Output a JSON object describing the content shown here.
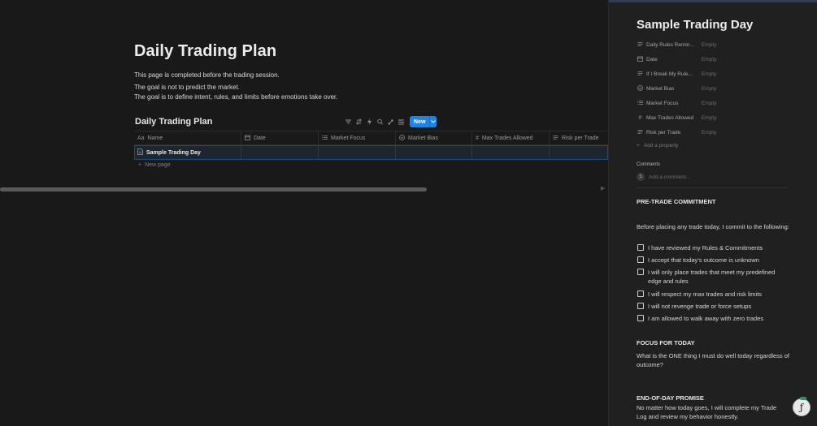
{
  "page": {
    "title": "Daily Trading Plan",
    "lines": [
      "This page is completed before the trading session.",
      "The goal is not to predict the market.",
      "The goal is to define intent, rules, and limits before emotions take over."
    ]
  },
  "database": {
    "title": "Daily Trading Plan",
    "new_label": "New",
    "toolbar_icons": [
      "filter-icon",
      "sort-icon",
      "automation-icon",
      "search-icon",
      "expand-icon",
      "settings-icon"
    ],
    "columns": [
      {
        "label": "Name",
        "icon": "Aa"
      },
      {
        "label": "Date",
        "icon": "calendar-icon"
      },
      {
        "label": "Market Focus",
        "icon": "list-icon"
      },
      {
        "label": "Market Bias",
        "icon": "select-icon"
      },
      {
        "label": "Max Trades Allowed",
        "icon": "#"
      },
      {
        "label": "Risk per Trade",
        "icon": "text-icon"
      }
    ],
    "rows": [
      {
        "name": "Sample Trading Day"
      }
    ],
    "new_page_label": "New page"
  },
  "panel": {
    "title": "Sample Trading Day",
    "properties": [
      {
        "name": "Daily Rules Remin...",
        "value": "Empty",
        "icon": "text-icon"
      },
      {
        "name": "Date",
        "value": "Empty",
        "icon": "calendar-icon"
      },
      {
        "name": "If I Break My Rule...",
        "value": "Empty",
        "icon": "text-icon"
      },
      {
        "name": "Market Bias",
        "value": "Empty",
        "icon": "select-icon"
      },
      {
        "name": "Market Focus",
        "value": "Empty",
        "icon": "list-icon"
      },
      {
        "name": "Max Trades Allowed",
        "value": "Empty",
        "icon": "number-icon"
      },
      {
        "name": "Risk per Trade",
        "value": "Empty",
        "icon": "text-icon"
      }
    ],
    "add_property": "Add a property",
    "comments_label": "Comments",
    "comment_avatar": "S",
    "comment_placeholder": "Add a comment...",
    "pre_trade_heading": "PRE-TRADE COMMITMENT",
    "pre_trade_intro": "Before placing any trade today, I commit to the following:",
    "commitments": [
      "I have reviewed my Rules & Commitments",
      "I accept that today's outcome is unknown",
      "I will only place trades that meet my predefined edge and rules",
      "I will respect my max trades and risk limits",
      "I will not revenge trade or force setups",
      "I am allowed to walk away with zero trades"
    ],
    "focus_heading": "FOCUS FOR TODAY",
    "focus_text": "What is the ONE thing I must do well today regardless of outcome?",
    "eod_heading": "END-OF-DAY PROMISE",
    "eod_text": "No matter how today goes, I will complete my Trade Log and review my behavior honestly."
  },
  "colors": {
    "background": "#191919",
    "panel": "#202020",
    "accent": "#2383e2"
  }
}
